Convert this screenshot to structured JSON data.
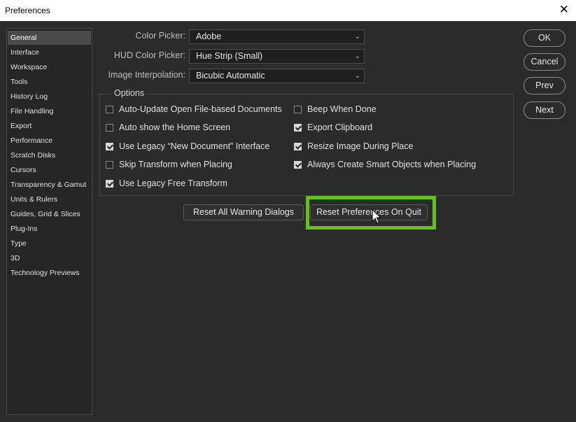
{
  "window": {
    "title": "Preferences"
  },
  "sidebar": {
    "items": [
      {
        "label": "General"
      },
      {
        "label": "Interface"
      },
      {
        "label": "Workspace"
      },
      {
        "label": "Tools"
      },
      {
        "label": "History Log"
      },
      {
        "label": "File Handling"
      },
      {
        "label": "Export"
      },
      {
        "label": "Performance"
      },
      {
        "label": "Scratch Disks"
      },
      {
        "label": "Cursors"
      },
      {
        "label": "Transparency & Gamut"
      },
      {
        "label": "Units & Rulers"
      },
      {
        "label": "Guides, Grid & Slices"
      },
      {
        "label": "Plug-Ins"
      },
      {
        "label": "Type"
      },
      {
        "label": "3D"
      },
      {
        "label": "Technology Previews"
      }
    ],
    "selected": "General"
  },
  "fields": {
    "color_picker": {
      "label": "Color Picker:",
      "value": "Adobe"
    },
    "hud_color_picker": {
      "label": "HUD Color Picker:",
      "value": "Hue Strip (Small)"
    },
    "image_interpolation": {
      "label": "Image Interpolation:",
      "value": "Bicubic Automatic"
    }
  },
  "options": {
    "legend": "Options",
    "left": [
      {
        "label": "Auto-Update Open File-based Documents",
        "checked": false
      },
      {
        "label": "Auto show the Home Screen",
        "checked": false
      },
      {
        "label": "Use Legacy “New Document” Interface",
        "checked": true
      },
      {
        "label": "Skip Transform when Placing",
        "checked": false
      },
      {
        "label": "Use Legacy Free Transform",
        "checked": true
      }
    ],
    "right": [
      {
        "label": "Beep When Done",
        "checked": false
      },
      {
        "label": "Export Clipboard",
        "checked": true
      },
      {
        "label": "Resize Image During Place",
        "checked": true
      },
      {
        "label": "Always Create Smart Objects when Placing",
        "checked": true
      }
    ]
  },
  "buttons": {
    "reset_warnings": "Reset All Warning Dialogs",
    "reset_prefs": "Reset Preferences On Quit",
    "ok": "OK",
    "cancel": "Cancel",
    "prev": "Prev",
    "next": "Next"
  },
  "colors": {
    "highlight": "#62c11c",
    "background": "#2b2b2b"
  }
}
